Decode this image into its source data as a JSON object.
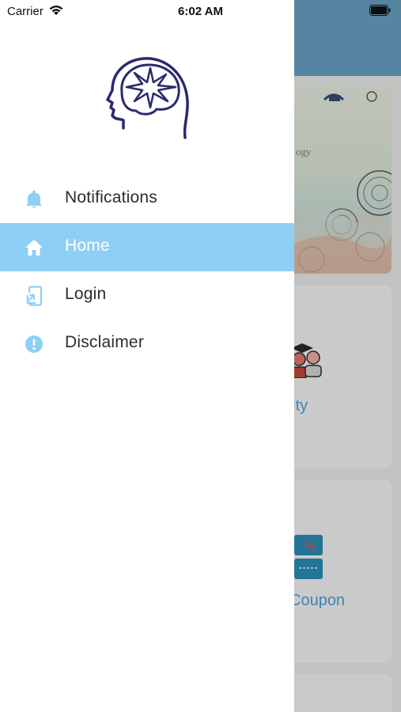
{
  "status_bar": {
    "carrier": "Carrier",
    "time": "6:02 AM",
    "icons": [
      "wifi-icon",
      "battery-icon"
    ]
  },
  "drawer": {
    "logo_icon": "brain-head-logo-icon",
    "menu": [
      {
        "label": "Notifications",
        "icon": "bell-icon",
        "active": false
      },
      {
        "label": "Home",
        "icon": "home-icon",
        "active": true
      },
      {
        "label": "Login",
        "icon": "login-icon",
        "active": false
      },
      {
        "label": "Disclaimer",
        "icon": "alert-circle-icon",
        "active": false
      }
    ]
  },
  "background": {
    "banner_text": "ogy",
    "cards": [
      {
        "label": "ulty",
        "icon": "faculty-people-icon"
      },
      {
        "label": "Coupon",
        "icon": "coupon-ticket-icon"
      }
    ]
  },
  "colors": {
    "active_item_bg": "#8ecff5",
    "icon_blue": "#8ecff5",
    "logo_navy": "#2a2a6e",
    "header_blue": "#6aa3c6",
    "card_label_blue": "#4aa3df"
  }
}
